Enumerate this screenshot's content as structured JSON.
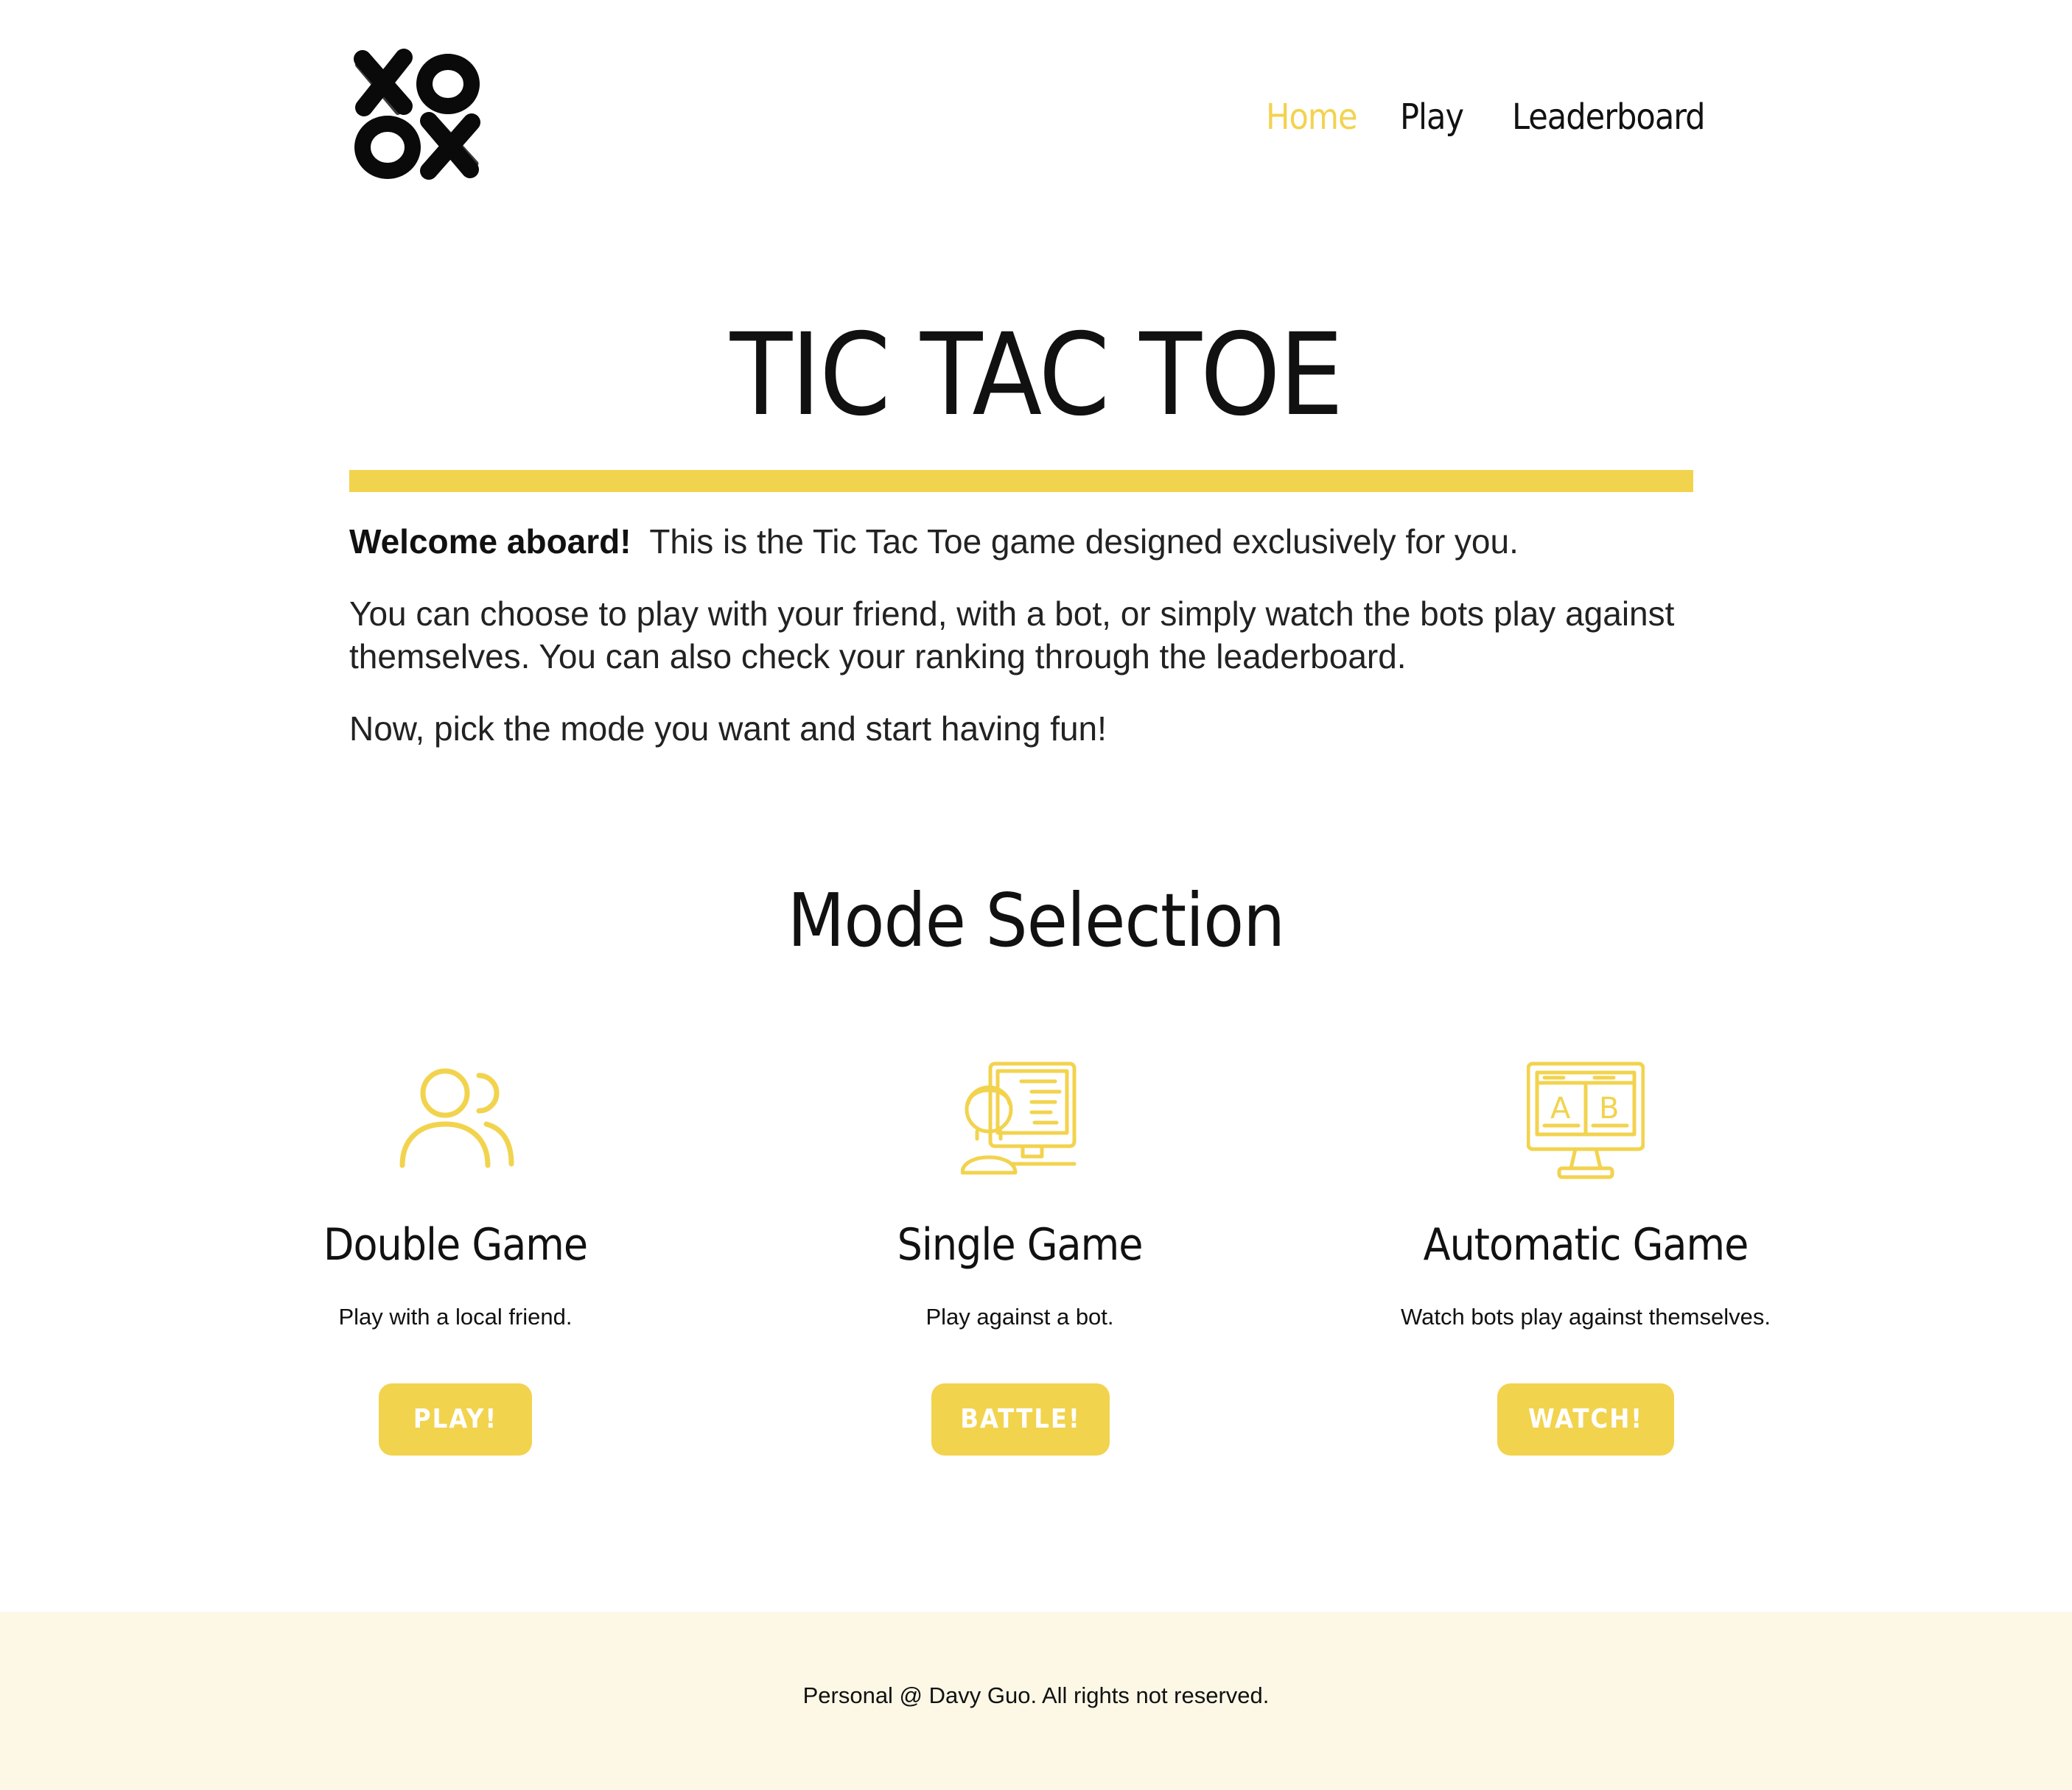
{
  "header": {
    "logo_icon": "xo-ox-logo-icon",
    "logo_letters": "XO OX",
    "nav": {
      "home": "Home",
      "play": "Play",
      "leaderboard": "Leaderboard"
    },
    "active_nav": "Home"
  },
  "hero": {
    "title": "TIC TAC TOE",
    "intro": {
      "welcome_bold": "Welcome aboard!",
      "welcome_rest": "This is the Tic Tac Toe game designed exclusively for you.",
      "paragraph2": "You can choose to play with your friend, with a bot, or simply watch the bots play against themselves. You can also check your ranking through the leaderboard.",
      "paragraph3": "Now, pick the mode you want and start having fun!"
    }
  },
  "modes": {
    "section_title": "Mode Selection",
    "items": [
      {
        "icon": "two-users-icon",
        "title": "Double Game",
        "description": "Play with a local friend.",
        "button_label": "PLAY!"
      },
      {
        "icon": "person-computer-icon",
        "title": "Single Game",
        "description": "Play against a bot.",
        "button_label": "BATTLE!"
      },
      {
        "icon": "ab-monitor-icon",
        "title": "Automatic Game",
        "description": "Watch bots play against themselves.",
        "button_label": "WATCH!",
        "icon_letters": [
          "A",
          "B"
        ]
      }
    ]
  },
  "footer": {
    "text": "Personal @ Davy Guo.  All rights not reserved."
  },
  "colors": {
    "accent": "#f2d34e",
    "text": "#111111",
    "footer_bg": "#fdf8e6",
    "button_text": "#ffffff"
  }
}
